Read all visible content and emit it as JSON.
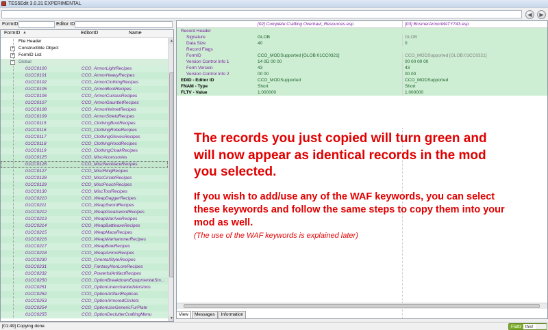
{
  "window": {
    "title": "TES5Edit 3.0.31 EXPERIMENTAL"
  },
  "toolbar": {
    "search_value": ""
  },
  "filters": {
    "formid_label": "FormID",
    "editorid_label": "Editor ID"
  },
  "tree": {
    "headers": [
      "FormID",
      "EditorID",
      "Name"
    ],
    "groups": [
      {
        "label": "File Header",
        "expander": ""
      },
      {
        "label": "Constructible Object",
        "expander": "+"
      },
      {
        "label": "FormID List",
        "expander": "+"
      }
    ],
    "global_label": "Global",
    "global_expander": "-",
    "records": [
      {
        "formid": "01CC0100",
        "editorid": "CCO_ArmorLightRecipes"
      },
      {
        "formid": "01CC0101",
        "editorid": "CCO_ArmorHeavyRecipes"
      },
      {
        "formid": "01CC0102",
        "editorid": "CCO_ArmorClothingRecipes"
      },
      {
        "formid": "01CC0105",
        "editorid": "CCO_ArmorBootRecipes"
      },
      {
        "formid": "01CC0106",
        "editorid": "CCO_ArmorCuirassRecipes"
      },
      {
        "formid": "01CC0107",
        "editorid": "CCO_ArmorGauntletRecipes"
      },
      {
        "formid": "01CC0108",
        "editorid": "CCO_ArmorHelmetRecipes"
      },
      {
        "formid": "01CC0109",
        "editorid": "CCO_ArmorShieldRecipes"
      },
      {
        "formid": "01CC0115",
        "editorid": "CCO_ClothingBootRecipes"
      },
      {
        "formid": "01CC0116",
        "editorid": "CCO_ClothingRobeRecipes"
      },
      {
        "formid": "01CC0117",
        "editorid": "CCO_ClothingGlovesRecipes"
      },
      {
        "formid": "01CC0118",
        "editorid": "CCO_ClothingHoodRecipes"
      },
      {
        "formid": "01CC0119",
        "editorid": "CCO_ClothingCloakRecipes"
      },
      {
        "formid": "01CC0125",
        "editorid": "CCO_MiscAccessories"
      },
      {
        "formid": "01CC0126",
        "editorid": "CCO_MiscNecklaceRecipes"
      },
      {
        "formid": "01CC0127",
        "editorid": "CCO_MiscRingRecipes"
      },
      {
        "formid": "01CC0128",
        "editorid": "CCO_MiscCircletRecipes"
      },
      {
        "formid": "01CC0129",
        "editorid": "CCO_MiscPouchRecipes"
      },
      {
        "formid": "01CC0130",
        "editorid": "CCO_MiscToolRecipes"
      },
      {
        "formid": "01CC0210",
        "editorid": "CCO_WeapDaggerRecipes"
      },
      {
        "formid": "01CC0211",
        "editorid": "CCO_WeapSwordRecipes"
      },
      {
        "formid": "01CC0212",
        "editorid": "CCO_WeapGreatswordRecipes"
      },
      {
        "formid": "01CC0213",
        "editorid": "CCO_WeapWarAxeRecipes"
      },
      {
        "formid": "01CC0214",
        "editorid": "CCO_WeapBattleaxeRecipes"
      },
      {
        "formid": "01CC0215",
        "editorid": "CCO_WeapMaceRecipes"
      },
      {
        "formid": "01CC0216",
        "editorid": "CCO_WeapWarhammerRecipes"
      },
      {
        "formid": "01CC0217",
        "editorid": "CCO_WeapBowRecipes"
      },
      {
        "formid": "01CC0218",
        "editorid": "CCO_WeapAmmoRecipes"
      },
      {
        "formid": "01CC0230",
        "editorid": "CCO_OrientalStyleRecipes"
      },
      {
        "formid": "01CC0231",
        "editorid": "CCO_FantasyNonLoreRecipes"
      },
      {
        "formid": "01CC0232",
        "editorid": "CCO_PowerfulArtifactRecipes"
      },
      {
        "formid": "01CC0250",
        "editorid": "CCO_OptionBreakdownEquipmentatSm..."
      },
      {
        "formid": "01CC0251",
        "editorid": "CCO_OptionUnenchantedVersions"
      },
      {
        "formid": "01CC0252",
        "editorid": "CCO_OptionArtifactReplicas"
      },
      {
        "formid": "01CC0253",
        "editorid": "CCO_OptionArmoredCirclets"
      },
      {
        "formid": "01CC0254",
        "editorid": "CCO_OptionUseGenericFurPlate"
      },
      {
        "formid": "01CC0255",
        "editorid": "CCO_OptionDeclutterCraftingMenu"
      }
    ],
    "selected_index": 14
  },
  "record_view": {
    "col_headers": [
      "[02] Complete Crafting Overhaul_Resources.esp",
      "[03] BosmerArmorMATY743.esp"
    ],
    "rows": [
      {
        "label": "Record Header",
        "v1": "",
        "v2": "",
        "indent": false,
        "bold": false
      },
      {
        "label": "Signature",
        "v1": "GLOB",
        "v2": "GLOB",
        "indent": true,
        "bold": false
      },
      {
        "label": "Data Size",
        "v1": "40",
        "v2": "0",
        "indent": true,
        "bold": false
      },
      {
        "label": "Record Flags",
        "v1": "",
        "v2": "",
        "indent": true,
        "bold": false
      },
      {
        "label": "FormID",
        "v1": "CCO_MODSupported [GLOB:01CC0321]",
        "v2": "CCO_MODSupported [GLOB:01CC0321]",
        "indent": true,
        "bold": false
      },
      {
        "label": "Version Control Info 1",
        "v1": "14 0D 00 00",
        "v2": "00 00 00 00",
        "indent": true,
        "bold": false
      },
      {
        "label": "Form Version",
        "v1": "43",
        "v2": "43",
        "indent": true,
        "bold": false
      },
      {
        "label": "Version Control Info 2",
        "v1": "00 00",
        "v2": "00 00",
        "indent": true,
        "bold": false
      },
      {
        "label": "EDID - Editor ID",
        "v1": "CCO_MODSupported",
        "v2": "CCO_MODSupported",
        "indent": false,
        "bold": true
      },
      {
        "label": "FNAM - Type",
        "v1": "Short",
        "v2": "Short",
        "indent": false,
        "bold": true
      },
      {
        "label": "FLTV - Value",
        "v1": "1.000000",
        "v2": "1.000000",
        "indent": false,
        "bold": true
      }
    ]
  },
  "tabs": [
    "View",
    "Messages",
    "Information"
  ],
  "overlay": {
    "main": "The records you just copied will turn green and will now appear as identical records in the mod you selected.",
    "sub": "If you wish to add/use any of the WAF keywords, you can select these keywords and follow the same steps to copy them into your mod as well.",
    "note": "(The use of the WAF keywords is explained later)"
  },
  "status": {
    "text": "[01:49] Copying done.",
    "flattr_label": "Flattr",
    "flattr_this": "this!"
  },
  "colors": {
    "record_green": "#cdeed3",
    "overlay_red": "#e00000",
    "formid_purple": "#7a1ea1"
  }
}
